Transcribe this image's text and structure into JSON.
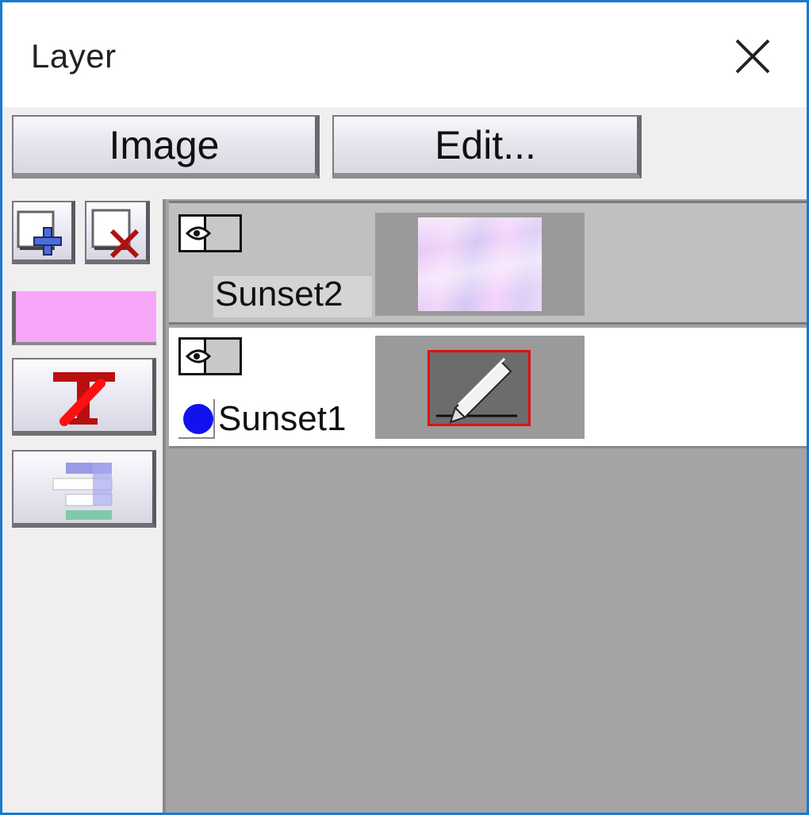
{
  "window": {
    "title": "Layer",
    "close_icon": "close-icon"
  },
  "toolbar": {
    "image_label": "Image",
    "edit_label": "Edit..."
  },
  "tools": {
    "new_layer_icon": "add-layer-icon",
    "delete_layer_icon": "delete-layer-icon",
    "color_swatch": "#f6a6f6",
    "text_tool_icon": "text-layer-icon",
    "arrange_icon": "arrange-layers-icon"
  },
  "layers": [
    {
      "name": "Sunset2",
      "visible": true,
      "selected": true,
      "thumbnail": "gradient-image"
    },
    {
      "name": "Sunset1",
      "visible": true,
      "selected": false,
      "active_dot_color": "#1212ee",
      "thumbnail": "pencil-drawing"
    }
  ]
}
